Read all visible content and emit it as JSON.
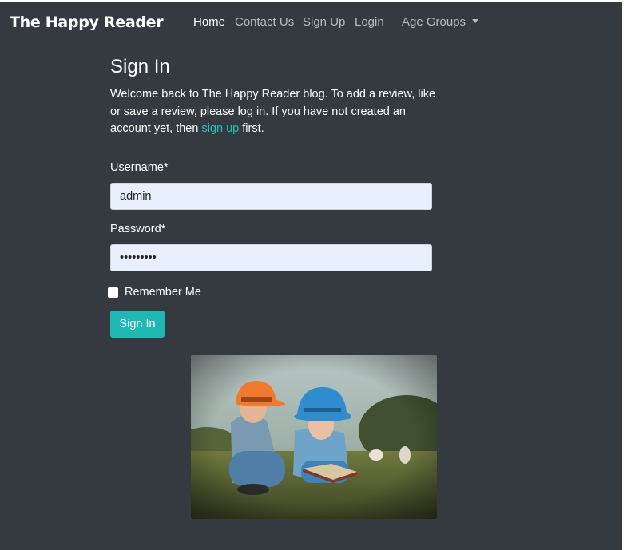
{
  "navbar": {
    "brand": "The Happy Reader",
    "links": [
      {
        "label": "Home",
        "active": true
      },
      {
        "label": "Contact Us",
        "active": false
      },
      {
        "label": "Sign Up",
        "active": false
      },
      {
        "label": "Login",
        "active": false
      },
      {
        "label": "Age Groups",
        "active": false,
        "dropdown": true
      }
    ]
  },
  "signin": {
    "title": "Sign In",
    "intro_before": "Welcome back to The Happy Reader blog. To add a review, like or save a review, please log in. If you have not created an account yet, then ",
    "intro_link": "sign up",
    "intro_after": " first.",
    "username_label": "Username*",
    "username_value": "admin",
    "password_label": "Password*",
    "password_value": "passworda",
    "remember_label": "Remember Me",
    "remember_checked": false,
    "submit_label": "Sign In"
  },
  "colors": {
    "background": "#343a40",
    "accent": "#20c3bc",
    "input_bg": "#e8f0fe"
  }
}
